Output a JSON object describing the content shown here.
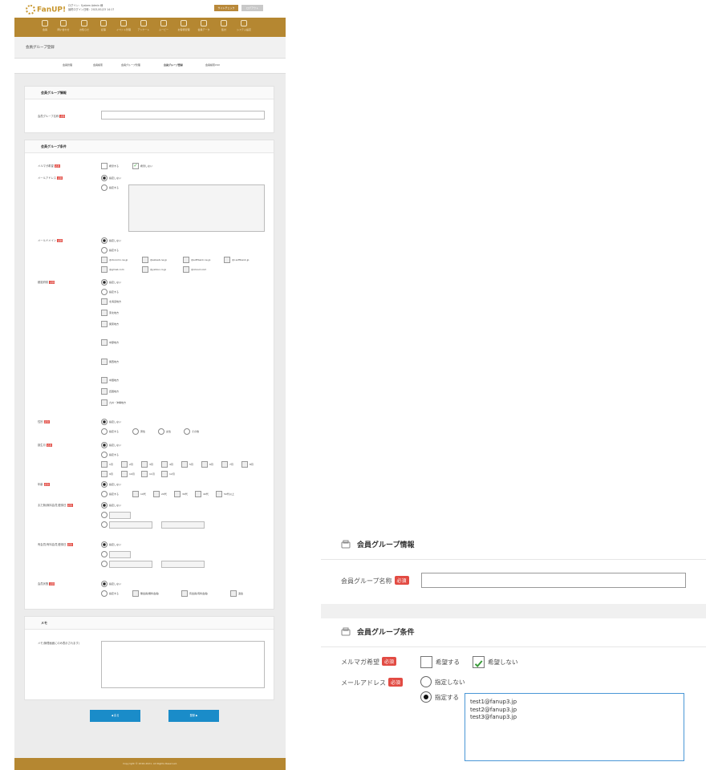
{
  "thumbnail": {
    "brand": "FanUP!",
    "login_line1": "ログイン：System Admin 様",
    "login_line2": "最終ログイン日時：2021/01/23 14:17",
    "site_check": "サイトチェック",
    "logout": "ログアウト",
    "nav": [
      "会員",
      "問い合わせ",
      "お知らせ",
      "記事",
      "イベント管理",
      "アンケート",
      "ムービー",
      "お客様管理",
      "会員データ",
      "集計",
      "システム設定"
    ],
    "page_title": "会員グループ登録",
    "subnav": [
      "会員管理",
      "会員検索",
      "会員グループ管理",
      "会員グループ登録",
      "会員検索CSV"
    ],
    "sec_info": "会員グループ情報",
    "group_name_label": "会員グループ名称",
    "required": "必須",
    "sec_cond": "会員グループ条件",
    "mail_magazine": "メルマガ希望",
    "mm_yes": "希望する",
    "mm_no": "希望しない",
    "mail_address": "メールアドレス",
    "not_specify": "指定しない",
    "specify": "指定する",
    "mail_domain": "メールドメイン",
    "domains": [
      "@docomo.ne.jp",
      "@ezweb.ne.jp",
      "@softbank.ne.jp",
      "@i.softbank.jp",
      "@gmail.com",
      "@yahoo.co.jp",
      "@icloud.com"
    ],
    "prefecture": "都道府県",
    "regions": [
      "北海道地方",
      "東北地方",
      "関東地方",
      "中部地方",
      "関西地方",
      "中国地方",
      "四国地方",
      "九州・沖縄地方"
    ],
    "gender": "性別",
    "gender_opts": [
      "男性",
      "女性",
      "その他"
    ],
    "birth_month": "誕生月",
    "months": [
      "1月",
      "2月",
      "3月",
      "4月",
      "5月",
      "6月",
      "7月",
      "8月",
      "9月",
      "10月",
      "11月",
      "12月"
    ],
    "age": "年齢",
    "age_opts": [
      "10代",
      "20代",
      "30代",
      "40代",
      "50代以上"
    ],
    "free_reg": "まだ無(無料会員)登録日",
    "paid_reg": "有会員(有料会員)登録日",
    "member_type": "会員状態",
    "member_type_opts": [
      "無会員(無料会員)",
      "有会員(有料会員)",
      "退会"
    ],
    "memo_section": "メモ",
    "memo_label": "メモ(管理画面にのみ表示されます)",
    "back_btn": "◀ 戻る",
    "submit_btn": "登録 ▶",
    "copyright": "Copyright © 2016-2021. All Rights Reserved."
  },
  "zoom": {
    "section_info_title": "会員グループ情報",
    "group_name_label": "会員グループ名称",
    "required": "必須",
    "section_cond_title": "会員グループ条件",
    "mail_magazine_label": "メルマガ希望",
    "mm_yes": "希望する",
    "mm_no": "希望しない",
    "mm_no_checked": true,
    "mail_address_label": "メールアドレス",
    "not_specify": "指定しない",
    "specify": "指定する",
    "mail_addresses": "test1@fanup3.jp\ntest2@fanup3.jp\ntest3@fanup3.jp"
  },
  "colors": {
    "brand_gold": "#b58731",
    "required_red": "#e24b43",
    "button_blue": "#1a8cc9",
    "focus_blue": "#4a97d6"
  }
}
